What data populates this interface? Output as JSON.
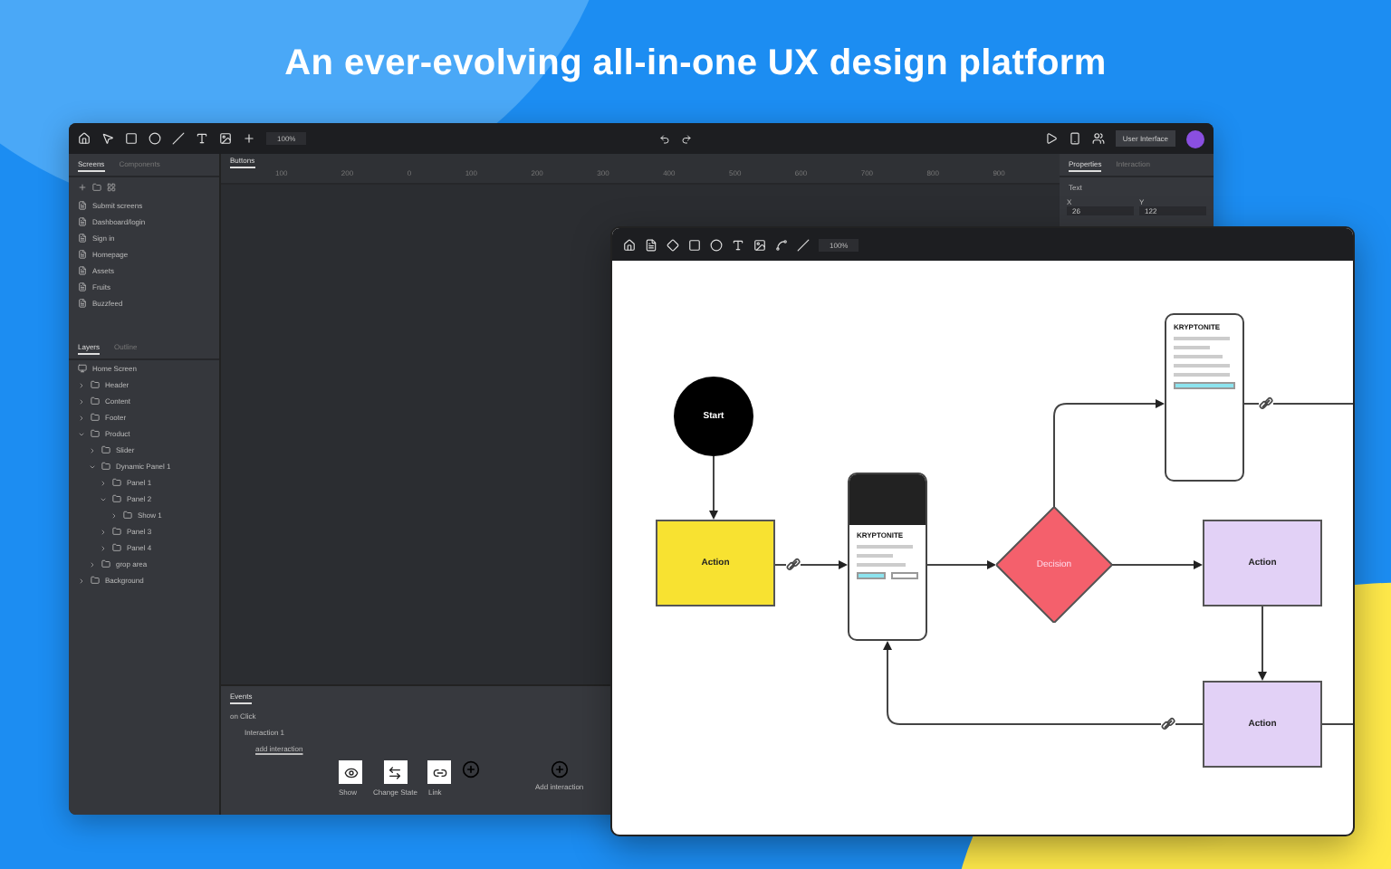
{
  "headline": "An ever-evolving all-in-one UX design platform",
  "editor": {
    "zoom": "100%",
    "left_tabs": [
      {
        "label": "Screens",
        "selected": true
      },
      {
        "label": "Components",
        "selected": false
      }
    ],
    "screens": [
      "Submit screens",
      "Dashboard/login",
      "Sign in",
      "Homepage",
      "Assets",
      "Fruits",
      "Buzzfeed"
    ],
    "layer_tabs": [
      {
        "label": "Layers",
        "selected": true
      },
      {
        "label": "Outline",
        "selected": false
      }
    ],
    "layer_root": "Home Screen",
    "layers": [
      {
        "label": "Header",
        "expanded": false
      },
      {
        "label": "Content",
        "expanded": false
      },
      {
        "label": "Footer",
        "expanded": false
      },
      {
        "label": "Product",
        "expanded": true,
        "children": [
          {
            "label": "Slider",
            "expanded": false
          },
          {
            "label": "Dynamic Panel 1",
            "expanded": true,
            "children": [
              {
                "label": "Panel 1",
                "expanded": false
              },
              {
                "label": "Panel 2",
                "expanded": true,
                "children": [
                  {
                    "label": "Show 1",
                    "expanded": false
                  }
                ]
              },
              {
                "label": "Panel 3",
                "expanded": false
              },
              {
                "label": "Panel 4",
                "expanded": false
              }
            ]
          },
          {
            "label": "grop area",
            "expanded": false
          }
        ]
      },
      {
        "label": "Background",
        "expanded": false
      }
    ],
    "canvas_tab": "Buttons",
    "ruler": [
      "100",
      "200",
      "0",
      "100",
      "200",
      "300",
      "400",
      "500",
      "600",
      "700",
      "800",
      "900"
    ],
    "properties_tabs": [
      {
        "label": "Properties",
        "selected": true
      },
      {
        "label": "Interaction",
        "selected": false
      }
    ],
    "properties_field": "Text",
    "coords": [
      {
        "label": "X",
        "value": "26"
      },
      {
        "label": "Y",
        "value": "122"
      }
    ],
    "share": "User Interface",
    "events": {
      "title": "Events",
      "trigger": "on Click",
      "condition": "Interaction 1",
      "action": "add interaction",
      "steps": [
        "Show",
        "Change State",
        "Link"
      ],
      "add_label": "Add interaction"
    }
  },
  "flow": {
    "zoom": "100%",
    "nodes": [
      {
        "kind": "start",
        "label": "Start"
      },
      {
        "kind": "action",
        "label": "Action",
        "color": "#f8e231"
      },
      {
        "kind": "screen",
        "label": "KRYPTONITE"
      },
      {
        "kind": "decision",
        "label": "Decision",
        "color": "#f4606c"
      },
      {
        "kind": "screen",
        "label": "KRYPTONITE"
      },
      {
        "kind": "action",
        "label": "Action",
        "color": "#e2d1f6"
      },
      {
        "kind": "action",
        "label": "Action",
        "color": "#e2d1f6"
      }
    ]
  }
}
